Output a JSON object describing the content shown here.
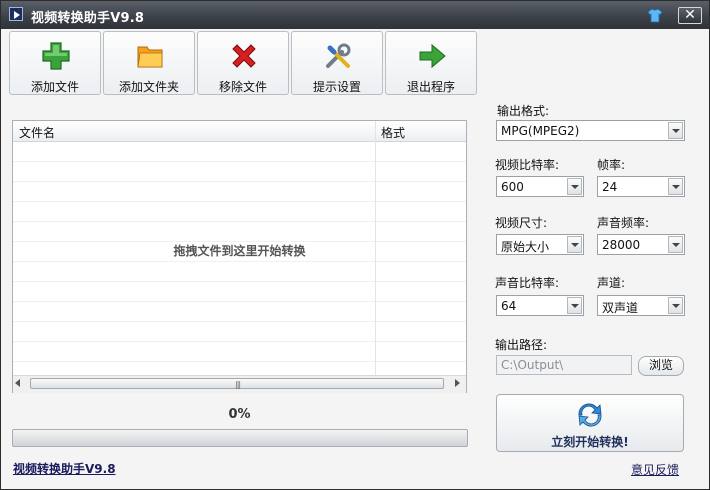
{
  "window": {
    "title": "视频转换助手V9.8",
    "close_glyph": "✕"
  },
  "toolbar": {
    "buttons": [
      {
        "label": "添加文件",
        "icon": "plus-icon"
      },
      {
        "label": "添加文件夹",
        "icon": "folder-icon"
      },
      {
        "label": "移除文件",
        "icon": "remove-icon"
      },
      {
        "label": "提示设置",
        "icon": "tools-icon"
      },
      {
        "label": "退出程序",
        "icon": "exit-arrow-icon"
      }
    ]
  },
  "file_list": {
    "columns": [
      "文件名",
      "格式"
    ],
    "empty_hint": "拖拽文件到这里开始转换",
    "scroll_grip": "|||"
  },
  "progress": {
    "label": "0%",
    "value": 0
  },
  "settings": {
    "output_format": {
      "label": "输出格式:",
      "value": "MPG(MPEG2)"
    },
    "video_bitrate": {
      "label": "视频比特率:",
      "value": "600"
    },
    "frame_rate": {
      "label": "帧率:",
      "value": "24"
    },
    "video_size": {
      "label": "视频尺寸:",
      "value": "原始大小"
    },
    "audio_sample_rate": {
      "label": "声音频率:",
      "value": "28000"
    },
    "audio_bitrate": {
      "label": "声音比特率:",
      "value": "64"
    },
    "channels": {
      "label": "声道:",
      "value": "双声道"
    },
    "output_path": {
      "label": "输出路径:",
      "value": "C:\\Output\\"
    },
    "browse_label": "浏览"
  },
  "start_button": {
    "label": "立刻开始转换!"
  },
  "footer": {
    "app_link": "视频转换助手V9.8",
    "feedback": "意见反馈"
  },
  "colors": {
    "accent_green": "#3aa33a",
    "accent_red": "#d42020",
    "folder_orange": "#f4a21e",
    "link_navy": "#1a1a5c"
  }
}
